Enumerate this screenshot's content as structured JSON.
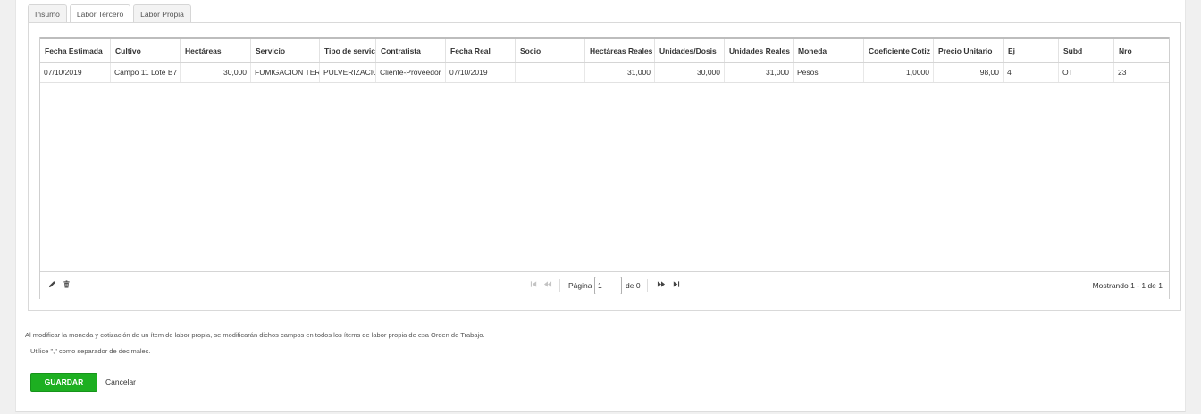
{
  "tabs": [
    {
      "label": "Insumo",
      "active": false
    },
    {
      "label": "Labor Tercero",
      "active": true
    },
    {
      "label": "Labor Propia",
      "active": false
    }
  ],
  "grid": {
    "columns": [
      "Fecha Estimada",
      "Cultivo",
      "Hectáreas",
      "Servicio",
      "Tipo de servicio",
      "Contratista",
      "Fecha Real",
      "Socio",
      "Hectáreas Reales",
      "Unidades/Dosis",
      "Unidades Reales",
      "Moneda",
      "Coeficiente Cotiz",
      "Precio Unitario",
      "Ej",
      "Subd",
      "Nro"
    ],
    "rows": [
      [
        "07/10/2019",
        "Campo 11 Lote B7",
        "30,000",
        "FUMIGACION TERRESTRE",
        "PULVERIZACION",
        "Cliente-Proveedor",
        "07/10/2019",
        "",
        "31,000",
        "30,000",
        "31,000",
        "Pesos",
        "1,0000",
        "98,00",
        "4",
        "OT",
        "23"
      ]
    ]
  },
  "pager": {
    "edit_icon": "pencil-icon",
    "delete_icon": "trash-icon",
    "page_label": "Página",
    "page_value": "1",
    "of_label": "de 0",
    "showing": "Mostrando 1 - 1 de 1"
  },
  "notes": {
    "currency_note": "Al modificar la moneda y cotización de un ítem de labor propia, se modificarán dichos campos en todos los ítems de labor propia de esa Orden de Trabajo.",
    "decimal_note": "Utilice \",\" como separador de decimales."
  },
  "actions": {
    "save_label": "GUARDAR",
    "cancel_label": "Cancelar"
  },
  "colors": {
    "save_button": "#1daf21"
  }
}
